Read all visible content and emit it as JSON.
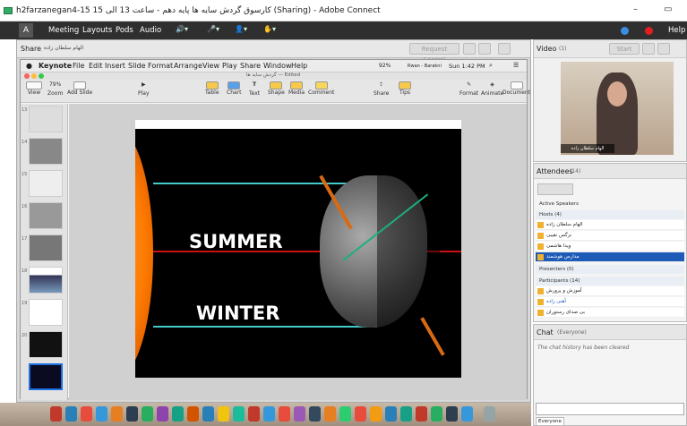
{
  "window": {
    "title": "h2farzanegan4-15 کارسوق گردش سایه ها پایه دهم - ساعت 13 الی 15 (Sharing) - Adobe Connect",
    "min": "–",
    "max": "▭"
  },
  "menubar": {
    "logo": "Adobe",
    "items": [
      "Meeting",
      "Layouts",
      "Pods",
      "Audio"
    ],
    "help": "Help"
  },
  "share": {
    "label": "Share",
    "presenter": "الهام سلطان زاده",
    "request_control": "Request Control"
  },
  "keynote": {
    "apple": "●",
    "menu": [
      "Keynote",
      "File",
      "Edit",
      "Insert",
      "Slide",
      "Format",
      "Arrange",
      "View",
      "Play",
      "Share",
      "Window",
      "Help"
    ],
    "battery": "92%",
    "user": "Rwan - Barakni",
    "clock": "Sun 1:42 PM",
    "doc_title": "گردش سایه ها — Edited",
    "toolbar_left": [
      {
        "label": "View"
      },
      {
        "label": "Zoom",
        "value": "79%"
      },
      {
        "label": "Add Slide"
      }
    ],
    "toolbar_center": [
      "Play",
      "Table",
      "Chart",
      "Text",
      "Shape",
      "Media",
      "Comment"
    ],
    "toolbar_right": [
      "Share",
      "Tips",
      "Format",
      "Animate",
      "Document"
    ],
    "slide_numbers": [
      "13",
      "14",
      "15",
      "16",
      "17",
      "18",
      "19",
      "20"
    ],
    "slide_words": [
      "SUMMER",
      "WINTER"
    ]
  },
  "video": {
    "label": "Video",
    "count": "(1)",
    "start": "Start",
    "name_tag": "الهام سلطان زاده"
  },
  "attendees": {
    "label": "Attendees",
    "count": "(14)",
    "active_speakers": "Active Speakers",
    "hosts_label": "Hosts (4)",
    "hosts": [
      "الهام سلطان زاده",
      "نرگس نقیبی",
      "ویدا هاشمی",
      "مدارس هوشمند"
    ],
    "presenters_label": "Presenters (0)",
    "participants_label": "Participants (14)",
    "participants": [
      "آموزش و پرورش",
      "آهنی زاده",
      "بی صدای رستوران"
    ]
  },
  "chat": {
    "label": "Chat",
    "scope": "(Everyone)",
    "cleared": "The chat history has been cleared",
    "tab": "Everyone"
  },
  "colors": {
    "menubar": "#2f2f2f",
    "selected_row": "#1e5bb6",
    "summer_line": "#cc1111",
    "equator_line": "#44cccc"
  }
}
